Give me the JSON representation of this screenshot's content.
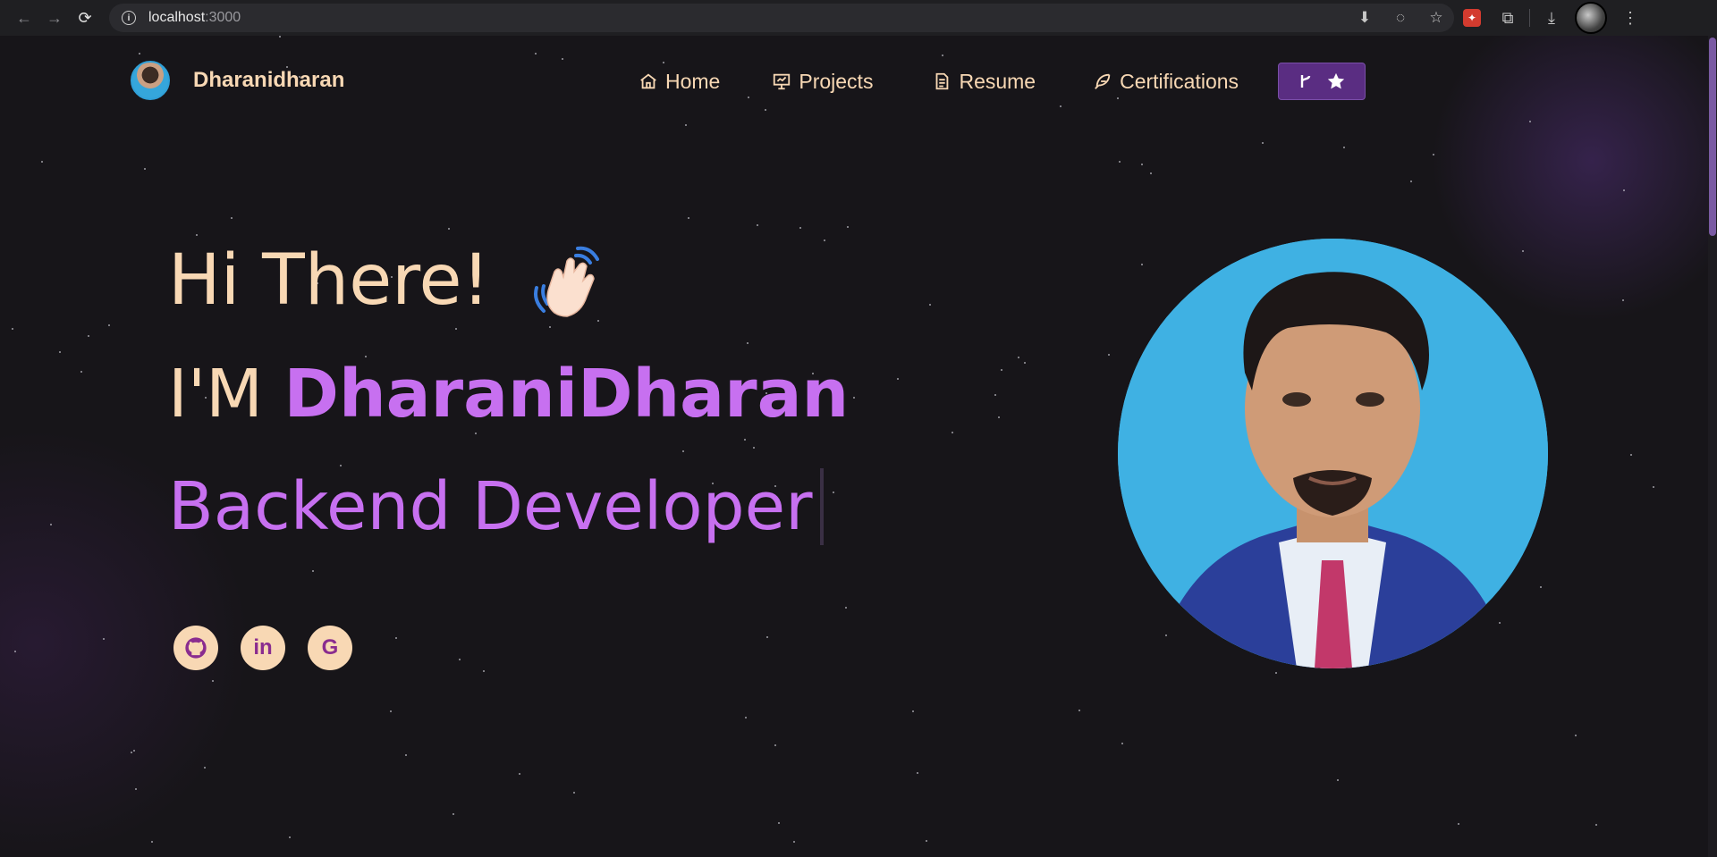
{
  "browser": {
    "url_host": "localhost",
    "url_port": ":3000"
  },
  "site": {
    "brand_name": "Dharanidharan"
  },
  "nav": {
    "items": [
      {
        "label": "Home",
        "icon": "home-icon"
      },
      {
        "label": "Projects",
        "icon": "presentation-icon"
      },
      {
        "label": "Resume",
        "icon": "document-icon"
      },
      {
        "label": "Certifications",
        "icon": "feather-icon"
      }
    ],
    "github_button_icons": [
      "git-fork-icon",
      "star-icon"
    ]
  },
  "hero": {
    "greeting": "Hi There!",
    "intro_prefix": "I'M ",
    "intro_name": "DharaniDharan",
    "role": "Backend Developer"
  },
  "socials": [
    {
      "name": "github",
      "glyph": "◉"
    },
    {
      "name": "linkedin",
      "glyph": "in"
    },
    {
      "name": "google",
      "glyph": "G"
    }
  ],
  "colors": {
    "background": "#171519",
    "accent_purple": "#c770f0",
    "peach_text": "#f8d8b4",
    "button_purple": "#5a2d82"
  }
}
